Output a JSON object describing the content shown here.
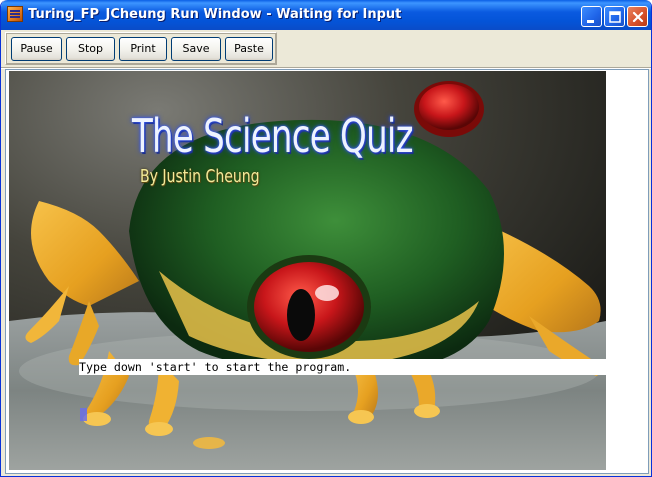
{
  "window": {
    "title": "Turing_FP_JCheung Run Window - Waiting for Input",
    "icon": "turing-app-icon",
    "controls": [
      "minimize-icon",
      "maximize-icon",
      "close-icon"
    ]
  },
  "toolbar": {
    "pause_label": "Pause",
    "stop_label": "Stop",
    "print_label": "Print",
    "save_label": "Save",
    "paste_label": "Paste"
  },
  "canvas": {
    "title": "The Science Quiz",
    "author": "By Justin Cheung",
    "prompt": "Type down 'start' to start the program.",
    "title_color": "#eef3ff",
    "author_color": "#f2ea9a"
  },
  "colors": {
    "titlebar": "#0a5ae0",
    "window_bg": "#ece9d8",
    "close_button": "#d5502a",
    "cursor": "#6b6fe6"
  }
}
